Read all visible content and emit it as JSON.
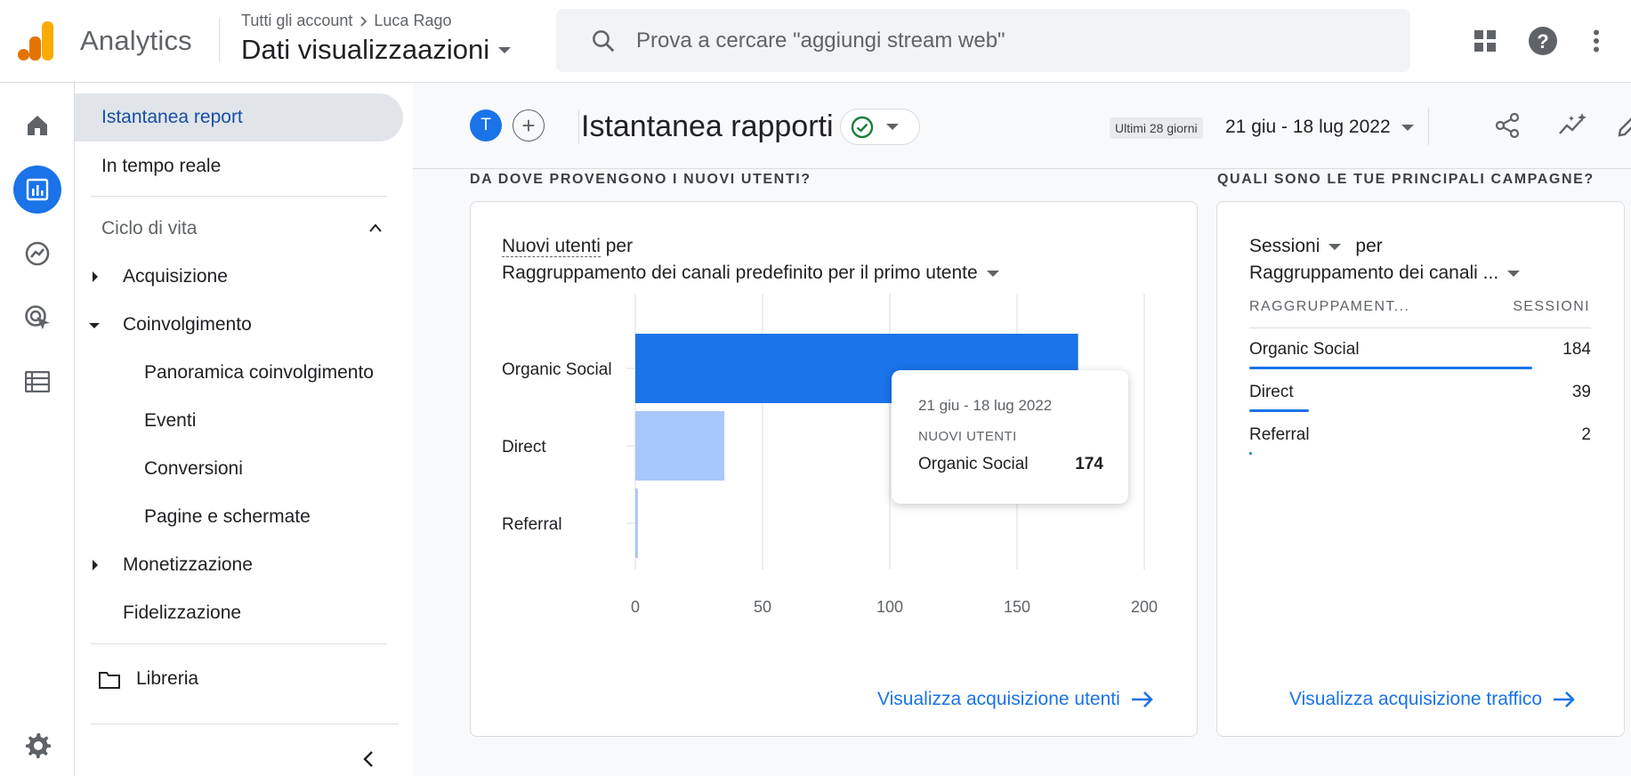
{
  "app": {
    "name": "Analytics"
  },
  "breadcrumb": {
    "all_accounts": "Tutti gli account",
    "account": "Luca Rago"
  },
  "property": {
    "name": "Dati visualizzaazioni"
  },
  "search": {
    "placeholder": "Prova a cercare \"aggiungi stream web\""
  },
  "sidebar": {
    "items": [
      {
        "label": "Istantanea report"
      },
      {
        "label": "In tempo reale"
      }
    ],
    "section": {
      "label": "Ciclo di vita"
    },
    "lifecycle": [
      {
        "label": "Acquisizione"
      },
      {
        "label": "Coinvolgimento"
      },
      {
        "label": "Panoramica coinvolgimento"
      },
      {
        "label": "Eventi"
      },
      {
        "label": "Conversioni"
      },
      {
        "label": "Pagine e schermate"
      },
      {
        "label": "Monetizzazione"
      },
      {
        "label": "Fidelizzazione"
      }
    ],
    "library": {
      "label": "Libreria"
    }
  },
  "report": {
    "avatar_letter": "T",
    "add_label": "+",
    "title": "Istantanea rapporti",
    "date_chip": "Ultimi 28 giorni",
    "date_range": "21 giu - 18 lug 2022"
  },
  "card1": {
    "section_title": "DA DOVE PROVENGONO I NUOVI UTENTI?",
    "metric": "Nuovi utenti",
    "per": "per",
    "dimension": "Raggruppamento dei canali predefinito per il primo utente",
    "link": "Visualizza acquisizione utenti",
    "tooltip": {
      "date": "21 giu - 18 lug 2022",
      "metric": "NUOVI UTENTI",
      "label": "Organic Social",
      "value": "174"
    }
  },
  "chart_data": {
    "type": "bar",
    "orientation": "horizontal",
    "categories": [
      "Organic Social",
      "Direct",
      "Referral"
    ],
    "values": [
      174,
      35,
      1
    ],
    "xticks": [
      "0",
      "50",
      "100",
      "150",
      "200"
    ],
    "xlim": [
      0,
      200
    ],
    "colors": [
      "#1a73e8",
      "#a8c7fa",
      "#a8c7fa"
    ],
    "grid": true
  },
  "card2": {
    "section_title": "QUALI SONO LE TUE PRINCIPALI CAMPAGNE?",
    "metric": "Sessioni",
    "per": "per",
    "dimension": "Raggruppamento dei canali ...",
    "col_dim": "RAGGRUPPAMENT...",
    "col_val": "SESSIONI",
    "rows": [
      {
        "label": "Organic Social",
        "value": "184",
        "share": 1.0
      },
      {
        "label": "Direct",
        "value": "39",
        "share": 0.212
      },
      {
        "label": "Referral",
        "value": "2",
        "share": 0.011
      }
    ],
    "link": "Visualizza acquisizione traffico"
  }
}
